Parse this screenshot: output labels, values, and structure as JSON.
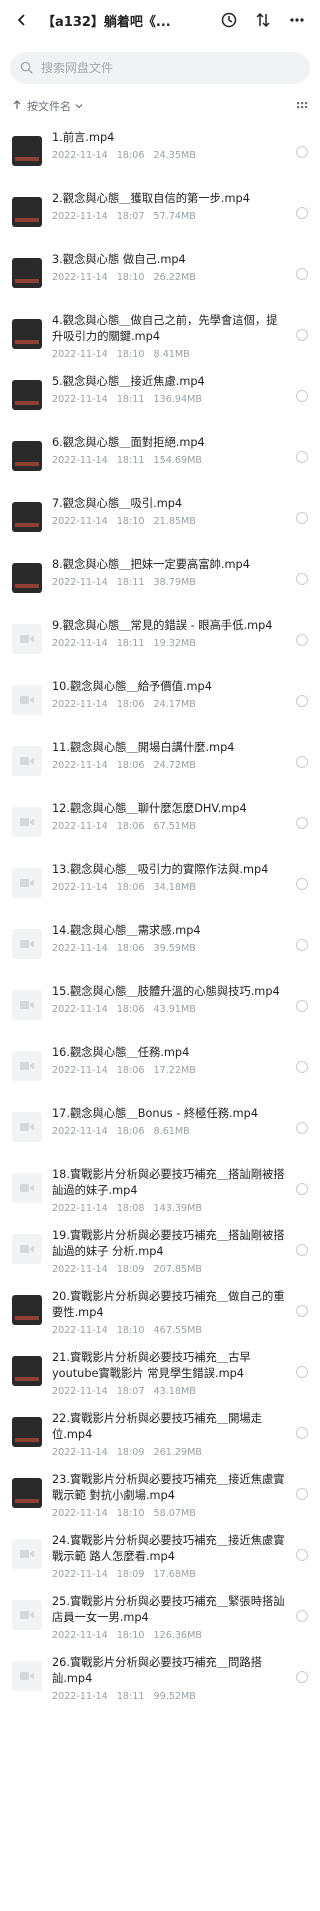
{
  "header": {
    "title": "【a132】躺着吧《..."
  },
  "search": {
    "placeholder": "搜索网盘文件"
  },
  "sort": {
    "label": "按文件名"
  },
  "files": [
    {
      "name": "1.前言.mp4",
      "date": "2022-11-14",
      "time": "18:06",
      "size": "24.35MB",
      "thumb": "image"
    },
    {
      "name": "2.觀念與心態＿獲取自信的第一步.mp4",
      "date": "2022-11-14",
      "time": "18:07",
      "size": "57.74MB",
      "thumb": "image"
    },
    {
      "name": "3.觀念與心態 做自己.mp4",
      "date": "2022-11-14",
      "time": "18:10",
      "size": "26.22MB",
      "thumb": "image"
    },
    {
      "name": "4.觀念與心態＿做自己之前，先學會這個，提升吸引力的關鍵.mp4",
      "date": "2022-11-14",
      "time": "18:10",
      "size": "8.41MB",
      "thumb": "image"
    },
    {
      "name": "5.觀念與心態＿接近焦慮.mp4",
      "date": "2022-11-14",
      "time": "18:11",
      "size": "136.94MB",
      "thumb": "image"
    },
    {
      "name": "6.觀念與心態＿面對拒絕.mp4",
      "date": "2022-11-14",
      "time": "18:11",
      "size": "154.69MB",
      "thumb": "image"
    },
    {
      "name": "7.觀念與心態＿吸引.mp4",
      "date": "2022-11-14",
      "time": "18:10",
      "size": "21.85MB",
      "thumb": "image"
    },
    {
      "name": "8.觀念與心態＿把妹一定要高富帥.mp4",
      "date": "2022-11-14",
      "time": "18:11",
      "size": "38.79MB",
      "thumb": "image"
    },
    {
      "name": "9.觀念與心態＿常見的錯誤 - 眼高手低.mp4",
      "date": "2022-11-14",
      "time": "18:11",
      "size": "19.32MB",
      "thumb": "video"
    },
    {
      "name": "10.觀念與心態＿給予價值.mp4",
      "date": "2022-11-14",
      "time": "18:06",
      "size": "24.17MB",
      "thumb": "video"
    },
    {
      "name": "11.觀念與心態＿開場白講什麼.mp4",
      "date": "2022-11-14",
      "time": "18:06",
      "size": "24.72MB",
      "thumb": "video"
    },
    {
      "name": "12.觀念與心態＿聊什麼怎麼DHV.mp4",
      "date": "2022-11-14",
      "time": "18:06",
      "size": "67.51MB",
      "thumb": "video"
    },
    {
      "name": "13.觀念與心態＿吸引力的實際作法與.mp4",
      "date": "2022-11-14",
      "time": "18:06",
      "size": "34.18MB",
      "thumb": "video"
    },
    {
      "name": "14.觀念與心態＿需求感.mp4",
      "date": "2022-11-14",
      "time": "18:06",
      "size": "39.59MB",
      "thumb": "video"
    },
    {
      "name": "15.觀念與心態＿肢體升溫的心態與技巧.mp4",
      "date": "2022-11-14",
      "time": "18:06",
      "size": "43.91MB",
      "thumb": "video"
    },
    {
      "name": "16.觀念與心態＿任務.mp4",
      "date": "2022-11-14",
      "time": "18:06",
      "size": "17.22MB",
      "thumb": "video"
    },
    {
      "name": "17.觀念與心態＿Bonus - 終極任務.mp4",
      "date": "2022-11-14",
      "time": "18:06",
      "size": "8.61MB",
      "thumb": "video"
    },
    {
      "name": "18.實戰影片分析與必要技巧補充＿搭訕剛被搭訕過的妹子.mp4",
      "date": "2022-11-14",
      "time": "18:08",
      "size": "143.39MB",
      "thumb": "video"
    },
    {
      "name": "19.實戰影片分析與必要技巧補充＿搭訕剛被搭訕過的妹子 分析.mp4",
      "date": "2022-11-14",
      "time": "18:09",
      "size": "207.85MB",
      "thumb": "video"
    },
    {
      "name": "20.實戰影片分析與必要技巧補充＿做自己的重要性.mp4",
      "date": "2022-11-14",
      "time": "18:10",
      "size": "467.55MB",
      "thumb": "image"
    },
    {
      "name": "21.實戰影片分析與必要技巧補充＿古早youtube實戰影片 常見學生錯誤.mp4",
      "date": "2022-11-14",
      "time": "18:07",
      "size": "43.18MB",
      "thumb": "image"
    },
    {
      "name": "22.實戰影片分析與必要技巧補充＿開場走位.mp4",
      "date": "2022-11-14",
      "time": "18:09",
      "size": "261.29MB",
      "thumb": "image"
    },
    {
      "name": "23.實戰影片分析與必要技巧補充＿接近焦慮實戰示範 對抗小劇場.mp4",
      "date": "2022-11-14",
      "time": "18:10",
      "size": "58.07MB",
      "thumb": "image"
    },
    {
      "name": "24.實戰影片分析與必要技巧補充＿接近焦慮實戰示範 路人怎麼看.mp4",
      "date": "2022-11-14",
      "time": "18:09",
      "size": "17.68MB",
      "thumb": "video"
    },
    {
      "name": "25.實戰影片分析與必要技巧補充＿緊張時搭訕店員一女一男.mp4",
      "date": "2022-11-14",
      "time": "18:10",
      "size": "126.36MB",
      "thumb": "video"
    },
    {
      "name": "26.實戰影片分析與必要技巧補充＿問路搭訕.mp4",
      "date": "2022-11-14",
      "time": "18:11",
      "size": "99.52MB",
      "thumb": "video"
    }
  ]
}
